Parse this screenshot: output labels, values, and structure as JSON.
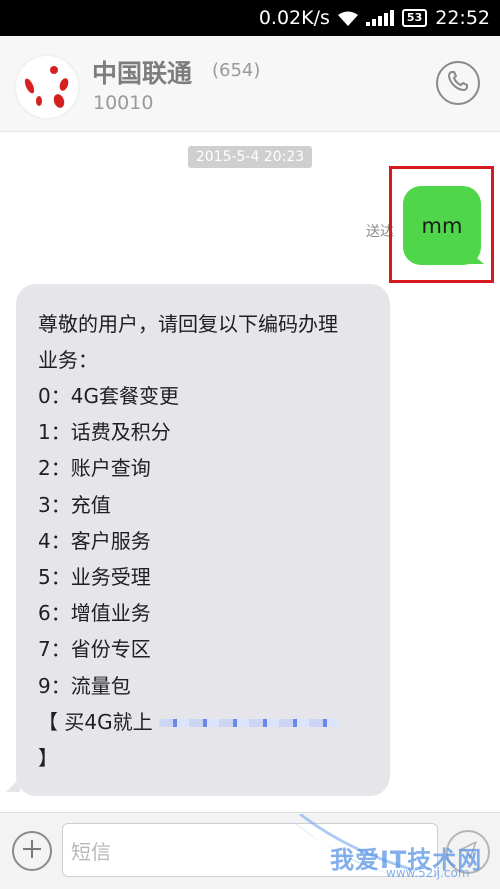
{
  "status_bar": {
    "speed": "0.02K/s",
    "battery": "53",
    "time": "22:52"
  },
  "header": {
    "contact_name": "中国联通",
    "message_count": "(654)",
    "contact_number": "10010"
  },
  "conversation": {
    "timestamp": "2015-5-4 20:23",
    "sent": {
      "status": "送达",
      "text": "mm"
    },
    "received": {
      "intro_lines": [
        "尊敬的用户，请回复以下编码办理",
        "业务："
      ],
      "options": [
        "0：4G套餐变更",
        "1：话费及积分",
        "2：账户查询",
        "3：充值",
        "4：客户服务",
        "5：业务受理",
        "6：增值业务",
        "7：省份专区",
        "9：流量包"
      ],
      "promo_prefix": "【 买4G就上 ",
      "promo_suffix": "】"
    }
  },
  "input_bar": {
    "placeholder": "短信"
  },
  "watermark": {
    "text": "我爱IT技术网",
    "url": "www.52ij.com"
  },
  "colors": {
    "sent_bubble": "#4fd64a",
    "received_bubble": "#e6e6ea",
    "highlight": "#d7191f"
  }
}
